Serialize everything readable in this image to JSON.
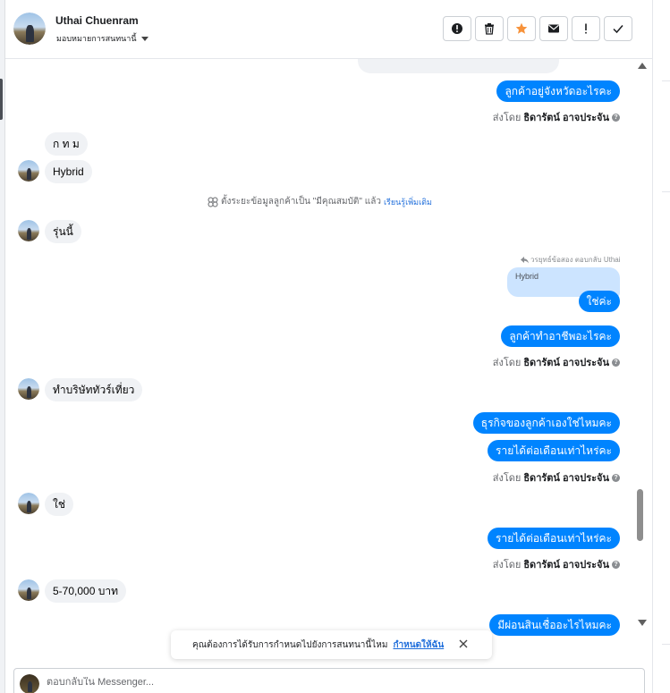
{
  "header": {
    "contact_name": "Uthai Chuenram",
    "assign_label": "มอบหมายการสนทนานี้"
  },
  "toolbar": {
    "buttons": [
      {
        "icon": "alert-circle-icon"
      },
      {
        "icon": "trash-icon"
      },
      {
        "icon": "star-icon",
        "color": "#f7923a"
      },
      {
        "icon": "envelope-icon"
      },
      {
        "icon": "exclamation-icon"
      },
      {
        "icon": "check-icon"
      }
    ]
  },
  "messages": {
    "m1": "ลูกค้าอยู่จังหวัดอะไรคะ",
    "sent_prefix": "ส่งโดย",
    "sender": "ธิดารัตน์ อาจประจัน",
    "help": "?",
    "m2": "ก ท ม",
    "m3": "Hybrid",
    "system_text": "ตั้งระยะข้อมูลลูกค้าเป็น \"มีคุณสมบัติ\" แล้ว",
    "system_link": "เรียนรู้เพิ่มเติม",
    "m4": "รุ่นนี้",
    "reply_header": "วรยุทธ์ข้อสอง ตอบกลับ Uthai",
    "quoted": "Hybrid",
    "m5": "ใช่ค่ะ",
    "m6": "ลูกค้าทำอาชีพอะไรคะ",
    "m7": "ทำบริษัททัวร์เที่ยว",
    "m8": "ธุรกิจของลูกค้าเองใช่ไหมคะ",
    "m9": "รายได้ต่อเดือนเท่าไหร่คะ",
    "m10": "ใช่",
    "m11": "รายได้ต่อเดือนเท่าไหร่คะ",
    "m12": "5-70,000 บาท",
    "m13": "มีผ่อนสินเชื่ออะไรไหมคะ"
  },
  "toast": {
    "text": "คุณต้องการได้รับการกำหนดไปยังการสนทนานี้ไหม",
    "link": "กำหนดให้ฉัน"
  },
  "composer": {
    "placeholder": "ตอบกลับใน Messenger..."
  },
  "colors": {
    "outgoing": "#0084ff",
    "incoming": "#f0f2f5",
    "star": "#f7923a"
  }
}
